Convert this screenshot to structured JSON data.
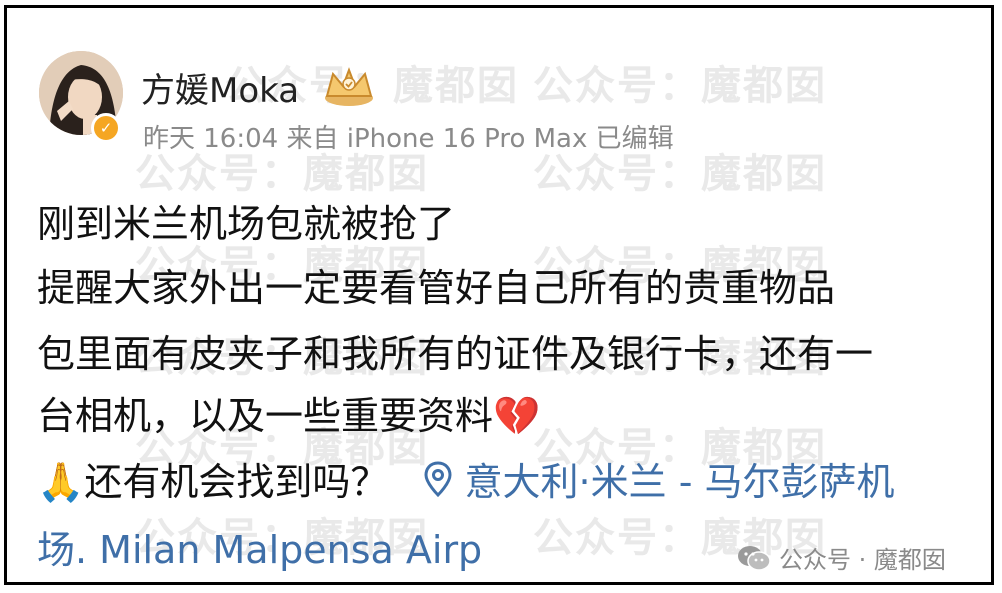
{
  "header": {
    "username": "方媛Moka",
    "meta": "昨天 16:04 来自 iPhone 16 Pro Max 已编辑"
  },
  "post": {
    "line1": "刚到米兰机场包就被抢了",
    "line2": "提醒大家外出一定要看管好自己所有的贵重物品",
    "line3": "包里面有皮夹子和我所有的证件及银行卡，还有一",
    "line4": "台相机，以及一些重要资料",
    "line4_emoji": "💔",
    "line5_emoji": "🙏",
    "line5_text": "还有机会找到吗？",
    "location_part1": "意大利·米兰 - 马尔彭萨机",
    "location_part2": "场. Milan Malpensa Airp"
  },
  "watermark": {
    "text": "公众号：魔都囡",
    "footer": "公众号 · 魔都囡"
  },
  "icons": {
    "verified": "verified-badge-icon",
    "crown": "crown-icon",
    "location": "location-pin-icon",
    "wechat": "wechat-icon"
  },
  "colors": {
    "link": "#3f6fa8",
    "meta": "#8a8a8a",
    "verified": "#f5a623"
  }
}
